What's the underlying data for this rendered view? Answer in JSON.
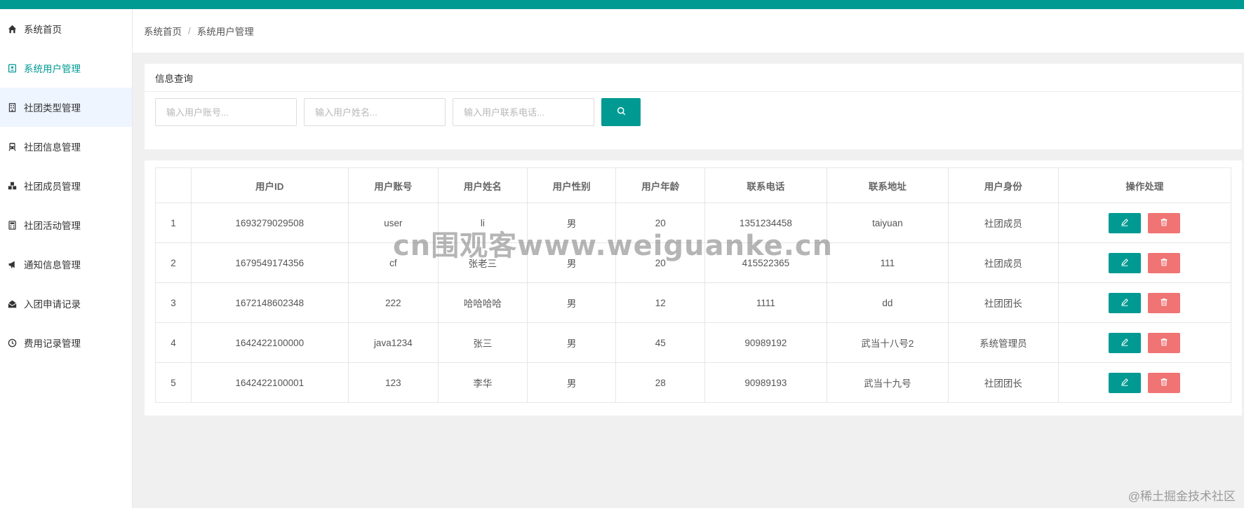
{
  "sidebar": {
    "items": [
      {
        "label": "系统首页",
        "icon": "home-icon"
      },
      {
        "label": "系统用户管理",
        "icon": "user-card-icon"
      },
      {
        "label": "社团类型管理",
        "icon": "building-icon"
      },
      {
        "label": "社团信息管理",
        "icon": "train-icon"
      },
      {
        "label": "社团成员管理",
        "icon": "cubes-icon"
      },
      {
        "label": "社团活动管理",
        "icon": "calculator-icon"
      },
      {
        "label": "通知信息管理",
        "icon": "bullhorn-icon"
      },
      {
        "label": "入团申请记录",
        "icon": "envelope-open-icon"
      },
      {
        "label": "费用记录管理",
        "icon": "clock-icon"
      }
    ]
  },
  "breadcrumb": {
    "home": "系统首页",
    "separator": "/",
    "current": "系统用户管理"
  },
  "search": {
    "title": "信息查询",
    "account_placeholder": "输入用户账号...",
    "name_placeholder": "输入用户姓名...",
    "phone_placeholder": "输入用户联系电话..."
  },
  "table": {
    "headers": [
      "",
      "用户ID",
      "用户账号",
      "用户姓名",
      "用户性别",
      "用户年龄",
      "联系电话",
      "联系地址",
      "用户身份",
      "操作处理"
    ],
    "rows": [
      [
        "1",
        "1693279029508",
        "user",
        "li",
        "男",
        "20",
        "1351234458",
        "taiyuan",
        "社团成员"
      ],
      [
        "2",
        "1679549174356",
        "cf",
        "张老三",
        "男",
        "20",
        "415522365",
        "111",
        "社团成员"
      ],
      [
        "3",
        "1672148602348",
        "222",
        "哈哈哈哈",
        "男",
        "12",
        "1111",
        "dd",
        "社团团长"
      ],
      [
        "4",
        "1642422100000",
        "java1234",
        "张三",
        "男",
        "45",
        "90989192",
        "武当十八号2",
        "系统管理员"
      ],
      [
        "5",
        "1642422100001",
        "123",
        "李华",
        "男",
        "28",
        "90989193",
        "武当十九号",
        "社团团长"
      ]
    ]
  },
  "watermark": "cn围观客www.weiguanke.cn",
  "corner_mark": "@稀土掘金技术社区",
  "colors": {
    "accent": "#009a93",
    "danger": "#f07474"
  }
}
